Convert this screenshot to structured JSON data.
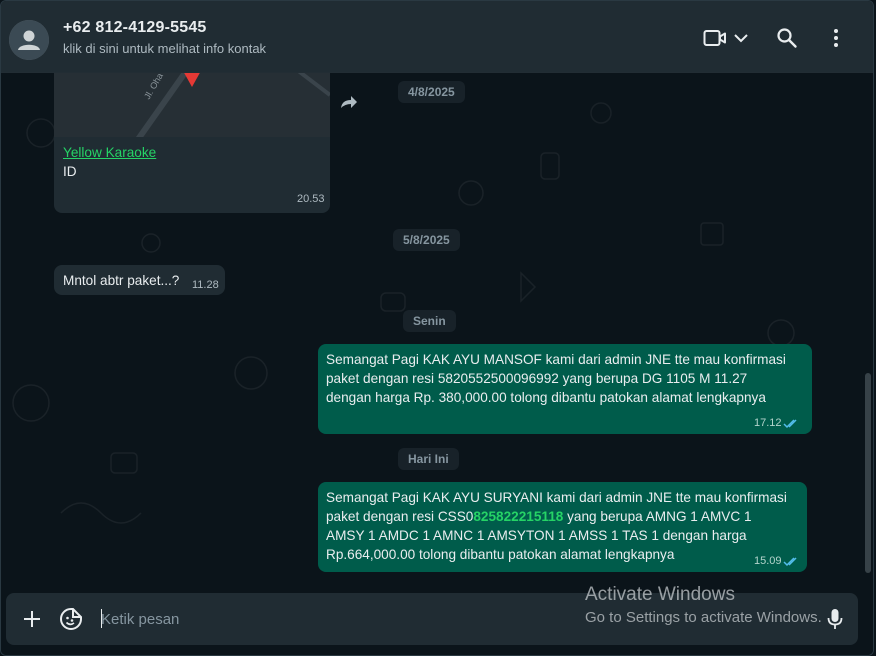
{
  "header": {
    "contact_name": "+62 812-4129-5545",
    "contact_subtitle": "klik di sini untuk melihat info kontak",
    "icons": [
      "video-call-icon",
      "chevron-down-icon",
      "search-icon",
      "menu-icon"
    ]
  },
  "messages": {
    "location": {
      "link": "Yellow Karaoke",
      "subtitle": "ID",
      "map_street": "Jl. Oha",
      "time": "20.53"
    },
    "date_1": "4/8/2025",
    "date_2": "5/8/2025",
    "incoming_1": {
      "text": "Mntol abtr paket...?",
      "time": "11.28"
    },
    "date_3": "Senin",
    "outgoing_1": {
      "line1": "Semangat Pagi KAK AYU MANSOF kami dari admin JNE tte mau konfirmasi",
      "line2": "paket dengan resi 5820552500096992 yang berupa DG 1105 M 11.27",
      "line3": "dengan harga Rp. 380,000.00 tolong dibantu patokan alamat lengkapnya",
      "time": "17.12"
    },
    "date_4": "Hari Ini",
    "outgoing_2": {
      "line1": "Semangat Pagi KAK AYU SURYANI kami dari admin JNE tte mau konfirmasi",
      "line2_prefix": "paket dengan resi CSS0",
      "line2_highlight": "825822215118",
      "line2_suffix": " yang berupa AMNG 1 AMVC 1",
      "line3": "AMSY 1 AMDC 1 AMNC 1 AMSYTON 1 AMSS 1 TAS 1 dengan harga",
      "line4": "Rp.664,000.00 tolong dibantu patokan alamat lengkapnya",
      "time": "15.09"
    }
  },
  "composer": {
    "placeholder": "Ketik pesan"
  },
  "watermark": {
    "title": "Activate Windows",
    "subtitle": "Go to Settings to activate Windows."
  },
  "colors": {
    "header_bg": "#202c33",
    "chat_bg": "#0b141a",
    "incoming_bubble": "#202c33",
    "outgoing_bubble": "#005c4b",
    "accent": "#25d366",
    "read_ticks": "#53bdeb"
  }
}
